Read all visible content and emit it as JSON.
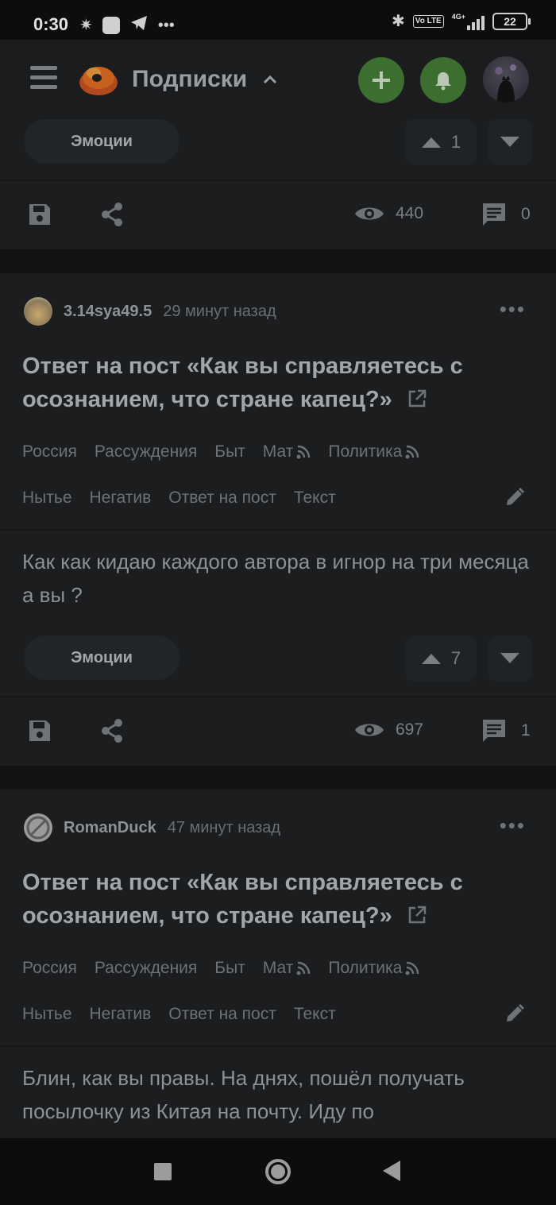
{
  "status_bar": {
    "time": "0:30",
    "battery": "22",
    "left_icons": [
      "brightness-icon",
      "mi-icon",
      "telegram-icon",
      "more-icon"
    ],
    "right_icons": [
      "bluetooth-icon",
      "volte-icon",
      "signal-icon",
      "battery-icon"
    ],
    "volte_label": "Vo LTE",
    "net_label": "4G+"
  },
  "header": {
    "title": "Подписки",
    "colors": {
      "add_button": "#3c6e2f",
      "bell_button": "#3c6e2f"
    }
  },
  "posts": [
    {
      "id": "partial-top",
      "emotions_label": "Эмоции",
      "votes": "1",
      "views": "440",
      "comments": "0"
    },
    {
      "id": "post-1",
      "author": "3.14sya49.5",
      "time": "29 минут назад",
      "title": "Ответ на пост «Как вы справляетесь с осознанием, что стране капец?»",
      "tags_row1": [
        "Россия",
        "Рассуждения",
        "Быт",
        "Мат",
        "Политика"
      ],
      "tags_row2": [
        "Нытье",
        "Негатив",
        "Ответ на пост",
        "Текст"
      ],
      "body": "Как как кидаю каждого автора в игнор на три месяца а вы ?",
      "emotions_label": "Эмоции",
      "votes": "7",
      "views": "697",
      "comments": "1"
    },
    {
      "id": "post-2",
      "author": "RomanDuck",
      "time": "47 минут назад",
      "title": "Ответ на пост «Как вы справляетесь с осознанием, что стране капец?»",
      "tags_row1": [
        "Россия",
        "Рассуждения",
        "Быт",
        "Мат",
        "Политика"
      ],
      "tags_row2": [
        "Нытье",
        "Негатив",
        "Ответ на пост",
        "Текст"
      ],
      "body": "Блин, как вы правы. На днях, пошёл получать посылочку из Китая на почту. Иду по"
    }
  ],
  "nav_bar": {
    "icons": [
      "recents-icon",
      "home-icon",
      "back-icon"
    ]
  }
}
